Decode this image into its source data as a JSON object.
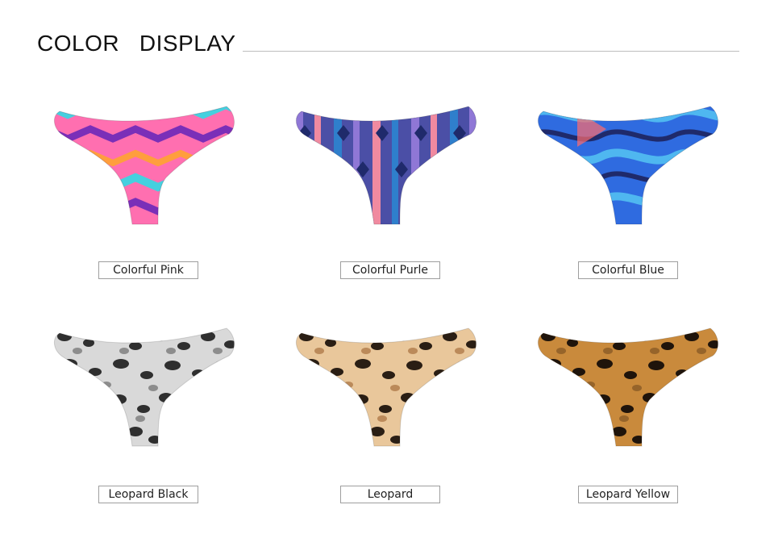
{
  "header": {
    "title": "COLOR   DISPLAY"
  },
  "products": [
    {
      "name": "Colorful Pink",
      "icon": "colorful-pink-thong-image",
      "colors": {
        "base": "#ff6fb0",
        "accent1": "#45d0df",
        "accent2": "#7a2fb8",
        "accent3": "#ff9e3d"
      }
    },
    {
      "name": "Colorful Purle",
      "icon": "colorful-purple-thong-image",
      "colors": {
        "base": "#4b4fa6",
        "accent1": "#8f77d6",
        "accent2": "#f08aa0",
        "accent3": "#2f7fcc"
      }
    },
    {
      "name": "Colorful Blue",
      "icon": "colorful-blue-thong-image",
      "colors": {
        "base": "#2f6be0",
        "accent1": "#1f2a6b",
        "accent2": "#4fb7f0",
        "accent3": "#ff6b6b"
      }
    },
    {
      "name": "Leopard Black",
      "icon": "leopard-black-thong-image",
      "colors": {
        "base": "#d9d9d9",
        "accent1": "#2f2f2f",
        "accent2": "#7a7a7a",
        "accent3": "#f2f2f2"
      }
    },
    {
      "name": "Leopard",
      "icon": "leopard-thong-image",
      "colors": {
        "base": "#e9c79b",
        "accent1": "#2a1e14",
        "accent2": "#b07b4a",
        "accent3": "#f4dfc3"
      }
    },
    {
      "name": "Leopard Yellow",
      "icon": "leopard-yellow-thong-image",
      "colors": {
        "base": "#c98a3c",
        "accent1": "#1f140b",
        "accent2": "#8a5a26",
        "accent3": "#e2b16a"
      }
    }
  ]
}
